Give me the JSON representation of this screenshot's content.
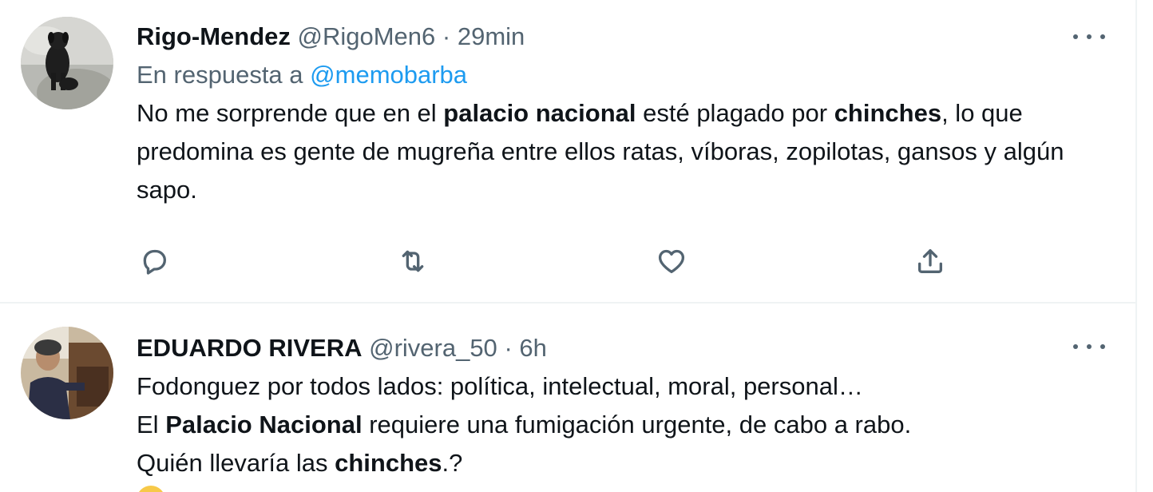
{
  "tweets": [
    {
      "name": "Rigo-Mendez",
      "handle": "@RigoMen6",
      "separator": "·",
      "time": "29min",
      "reply_prefix": "En respuesta a",
      "reply_mention": "@memobarba",
      "text_parts": [
        {
          "t": "No me sorprende que en el ",
          "bold": false
        },
        {
          "t": "palacio nacional",
          "bold": true
        },
        {
          "t": " esté plagado por ",
          "bold": false
        },
        {
          "t": "chinches",
          "bold": true
        },
        {
          "t": ", lo que predomina es gente de mugreña entre ellos ratas, víboras, zopilotas, gansos y algún sapo.",
          "bold": false
        }
      ],
      "avatar_icon": "dog-avatar-photo"
    },
    {
      "name": "EDUARDO RIVERA",
      "handle": "@rivera_50",
      "separator": "·",
      "time": "6h",
      "lines": [
        [
          {
            "t": "Fodonguez por todos lados: política, intelectual, moral, personal…",
            "bold": false
          }
        ],
        [
          {
            "t": "El ",
            "bold": false
          },
          {
            "t": "Palacio Nacional",
            "bold": true
          },
          {
            "t": " requiere una fumigación urgente, de cabo a rabo.",
            "bold": false
          }
        ],
        [
          {
            "t": "Quién llevaría las ",
            "bold": false
          },
          {
            "t": "chinches",
            "bold": true
          },
          {
            "t": ".?",
            "bold": false
          }
        ]
      ],
      "avatar_icon": "man-avatar-photo"
    }
  ],
  "actions": [
    "reply-icon",
    "retweet-icon",
    "like-icon",
    "share-icon"
  ],
  "colors": {
    "text": "#0f1419",
    "secondary": "#536471",
    "link": "#1d9bf0",
    "divider": "#eff3f4"
  }
}
